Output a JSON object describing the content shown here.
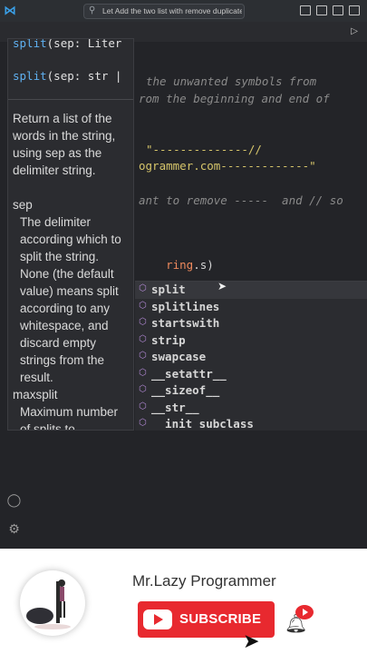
{
  "titlebar": {
    "search_text": "Let Add the two list with remove duplicates"
  },
  "code_lines": [
    {
      "text": "the unwanted symbols from",
      "kind": "comment"
    },
    {
      "text": "rom the beginning and end of",
      "kind": "comment"
    },
    {
      "text": "\"--------------//",
      "kind": "string"
    },
    {
      "text": "ogrammer.com-------------\"",
      "kind": "string"
    },
    {
      "text": "ant to remove -----  and // so",
      "kind": "comment"
    }
  ],
  "cursor_line": {
    "var": "ring",
    "rest": ".s)"
  },
  "signature": {
    "line1": "split(sep: Liter",
    "line1_prefix": "split",
    "line1_rest": "(sep: Liter",
    "line2": "split(sep: str |",
    "line2_prefix": "split",
    "line2_rest": "(sep: str |"
  },
  "doc": {
    "summary": "Return a list of the words in the string, using sep as the delimiter string.",
    "param1_name": "sep",
    "param1_desc": "The delimiter according which to split the string. None (the default value) means split according to any whitespace, and discard empty strings from the result.",
    "param2_name": "maxsplit",
    "param2_desc": "Maximum number of splits to"
  },
  "completion_items": [
    {
      "label": "split",
      "icon": "method-cube-icon",
      "selected": true
    },
    {
      "label": "splitlines",
      "icon": "method-cube-icon",
      "selected": false
    },
    {
      "label": "startswith",
      "icon": "method-cube-icon",
      "selected": false
    },
    {
      "label": "strip",
      "icon": "method-cube-icon",
      "selected": false
    },
    {
      "label": "swapcase",
      "icon": "method-cube-icon",
      "selected": false
    },
    {
      "label": "__setattr__",
      "icon": "method-cube-icon",
      "selected": false
    },
    {
      "label": "__sizeof__",
      "icon": "method-cube-icon",
      "selected": false
    },
    {
      "label": "__str__",
      "icon": "method-cube-icon",
      "selected": false
    },
    {
      "label": "  init subclass",
      "icon": "method-cube-icon",
      "selected": false
    }
  ],
  "banner": {
    "channel_name": "Mr.Lazy Programmer",
    "subscribe_label": "SUBSCRIBE"
  },
  "colors": {
    "editor_bg": "#232428",
    "popup_bg": "#2b2c30",
    "comment": "#8a8a8a",
    "string": "#d6c56a",
    "keyword": "#5fb0f0",
    "subscribe_red": "#e8292f"
  }
}
